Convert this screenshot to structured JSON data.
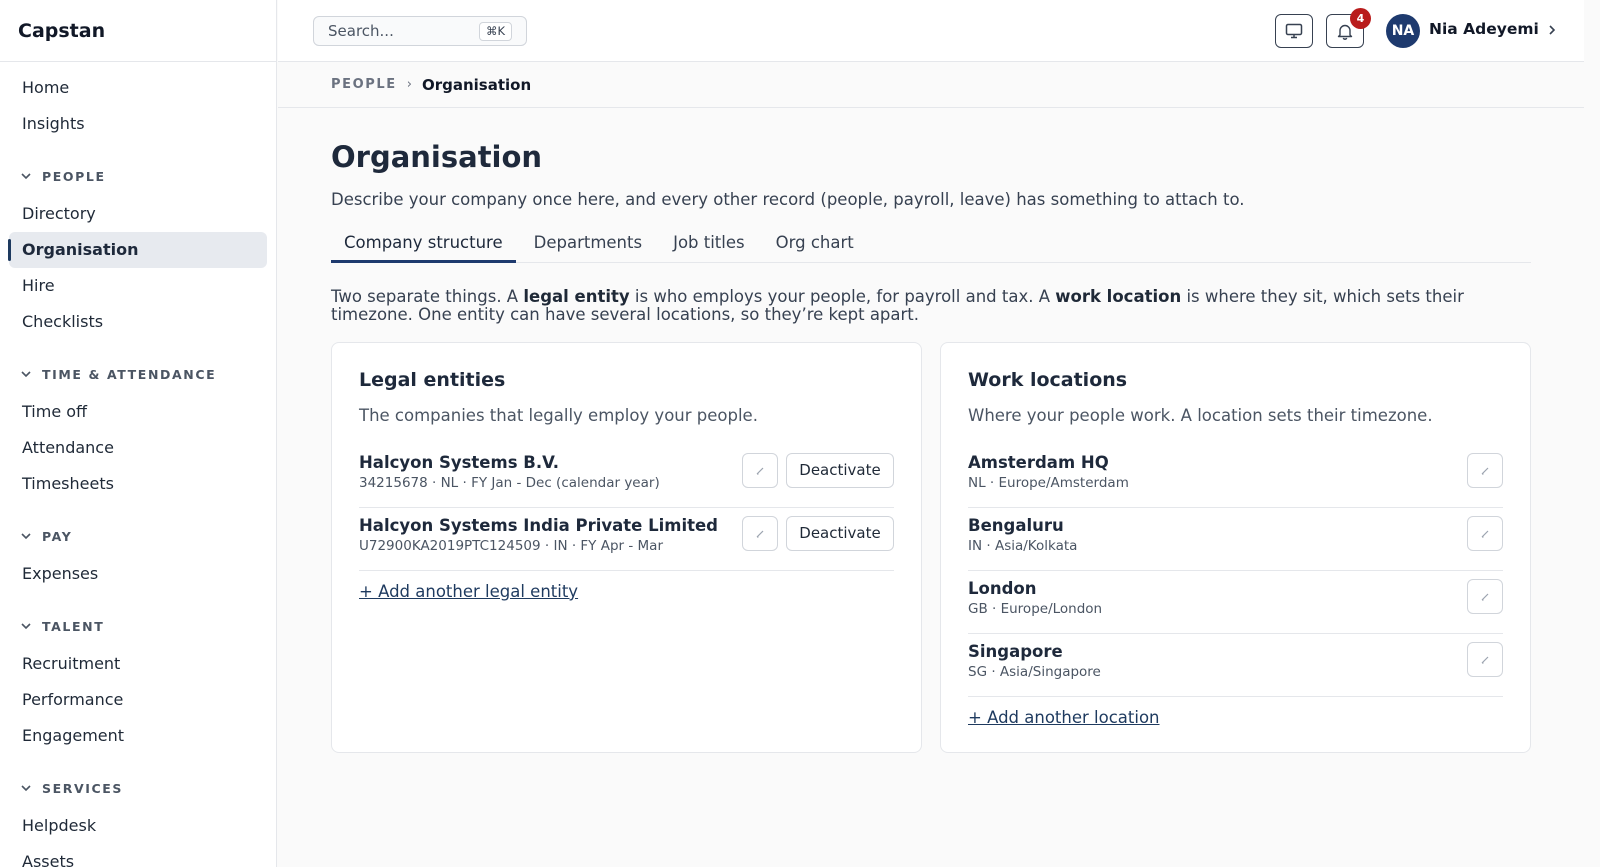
{
  "app": {
    "name": "Capstan"
  },
  "sidebar": {
    "top_items": [
      {
        "label": "Home"
      },
      {
        "label": "Insights"
      }
    ],
    "groups": [
      {
        "label": "PEOPLE",
        "items": [
          {
            "label": "Directory"
          },
          {
            "label": "Organisation"
          },
          {
            "label": "Hire"
          },
          {
            "label": "Checklists"
          }
        ]
      },
      {
        "label": "TIME & ATTENDANCE",
        "items": [
          {
            "label": "Time off"
          },
          {
            "label": "Attendance"
          },
          {
            "label": "Timesheets"
          }
        ]
      },
      {
        "label": "PAY",
        "items": [
          {
            "label": "Expenses"
          }
        ]
      },
      {
        "label": "TALENT",
        "items": [
          {
            "label": "Recruitment"
          },
          {
            "label": "Performance"
          },
          {
            "label": "Engagement"
          }
        ]
      },
      {
        "label": "SERVICES",
        "items": [
          {
            "label": "Helpdesk"
          },
          {
            "label": "Assets"
          }
        ]
      }
    ],
    "active_item": "Organisation"
  },
  "topbar": {
    "search_placeholder": "Search...",
    "search_shortcut": "⌘K",
    "notification_count": "4",
    "user": {
      "initials": "NA",
      "name": "Nia Adeyemi"
    }
  },
  "breadcrumb": {
    "parent": "PEOPLE",
    "current": "Organisation"
  },
  "page": {
    "title": "Organisation",
    "description": "Describe your company once here, and every other record (people, payroll, leave) has something to attach to.",
    "tabs": [
      {
        "label": "Company structure"
      },
      {
        "label": "Departments"
      },
      {
        "label": "Job titles"
      },
      {
        "label": "Org chart"
      }
    ],
    "active_tab": "Company structure",
    "intro": {
      "part1": "Two separate things. A ",
      "bold1": "legal entity",
      "part2": " is who employs your people, for payroll and tax. A ",
      "bold2": "work location",
      "part3": " is where they sit, which sets their timezone. One entity can have several locations, so they’re kept apart."
    }
  },
  "legal_entities": {
    "title": "Legal entities",
    "subtitle": "The companies that legally employ your people.",
    "deactivate_label": "Deactivate",
    "items": [
      {
        "name": "Halcyon Systems B.V.",
        "meta": "34215678 · NL · FY Jan - Dec (calendar year)"
      },
      {
        "name": "Halcyon Systems India Private Limited",
        "meta": "U72900KA2019PTC124509 · IN · FY Apr - Mar"
      }
    ],
    "add_label": "+ Add another legal entity"
  },
  "work_locations": {
    "title": "Work locations",
    "subtitle": "Where your people work. A location sets their timezone.",
    "items": [
      {
        "name": "Amsterdam HQ",
        "meta": "NL · Europe/Amsterdam"
      },
      {
        "name": "Bengaluru",
        "meta": "IN · Asia/Kolkata"
      },
      {
        "name": "London",
        "meta": "GB · Europe/London"
      },
      {
        "name": "Singapore",
        "meta": "SG · Asia/Singapore"
      }
    ],
    "add_label": "+ Add another location"
  },
  "colors": {
    "accent": "#1e3a6e",
    "badge": "#b91c1c",
    "active_nav_bg": "#e7eaef"
  },
  "icons": {
    "monitor": "monitor-icon",
    "bell": "bell-icon",
    "edit": "pencil-icon",
    "chevron": "chevron-down-icon"
  }
}
